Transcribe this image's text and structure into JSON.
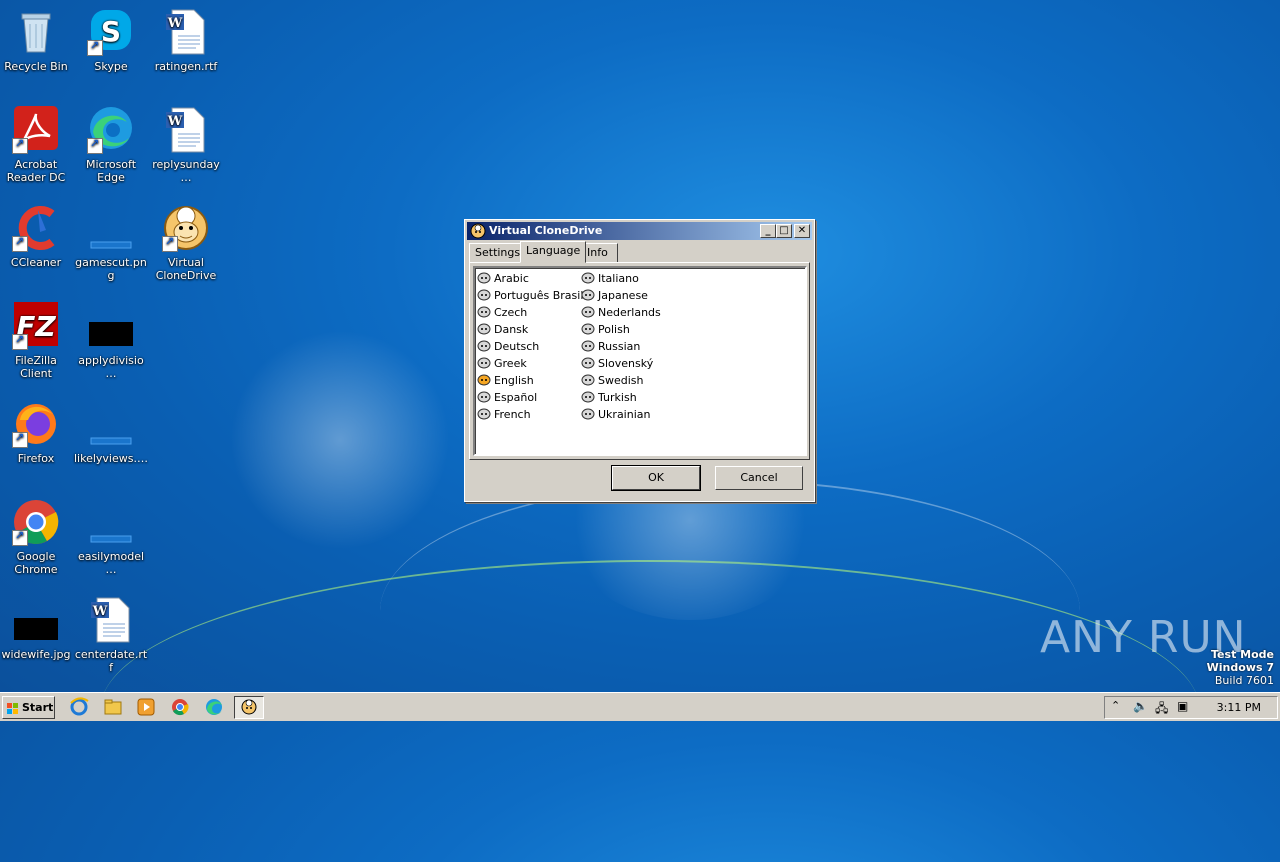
{
  "desktop": {
    "icons": [
      {
        "label": "Recycle Bin"
      },
      {
        "label": "Skype"
      },
      {
        "label": "ratingen.rtf"
      },
      {
        "label": "Acrobat Reader DC"
      },
      {
        "label": "Microsoft Edge"
      },
      {
        "label": "replysunday…"
      },
      {
        "label": "CCleaner"
      },
      {
        "label": "gamescut.png"
      },
      {
        "label": "Virtual CloneDrive"
      },
      {
        "label": "FileZilla Client"
      },
      {
        "label": "applydivisio…"
      },
      {
        "label": "Firefox"
      },
      {
        "label": "likelyviews.…"
      },
      {
        "label": "Google Chrome"
      },
      {
        "label": "easilymodel…"
      },
      {
        "label": "widewife.jpg"
      },
      {
        "label": "centerdate.rtf"
      }
    ]
  },
  "window": {
    "title": "Virtual CloneDrive",
    "tabs": [
      {
        "label": "Settings"
      },
      {
        "label": "Language"
      },
      {
        "label": "Info"
      }
    ],
    "active_tab": "Language",
    "languages_col1": [
      "Arabic",
      "Português Brasil",
      "Czech",
      "Dansk",
      "Deutsch",
      "Greek",
      "English",
      "Español",
      "French"
    ],
    "languages_col2": [
      "Italiano",
      "Japanese",
      "Nederlands",
      "Polish",
      "Russian",
      "Slovenský",
      "Swedish",
      "Turkish",
      "Ukrainian"
    ],
    "selected_language": "English",
    "ok_label": "OK",
    "cancel_label": "Cancel"
  },
  "taskbar": {
    "start_label": "Start",
    "clock": "3:11 PM"
  },
  "watermark": {
    "line1": "Test Mode",
    "line2": "Windows 7",
    "line3": "Build 7601",
    "brand": "ANY RUN"
  }
}
